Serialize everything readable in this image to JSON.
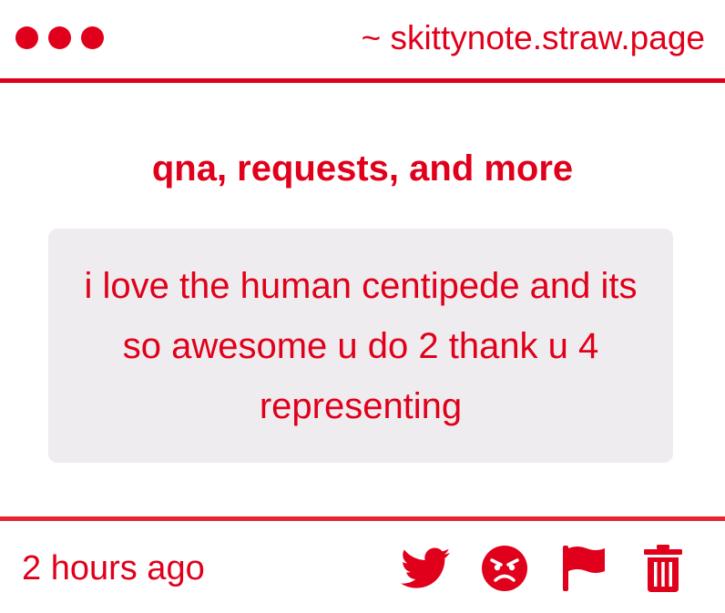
{
  "window": {
    "url": "~ skittynote.straw.page",
    "dots": [
      "dot",
      "dot",
      "dot"
    ]
  },
  "colors": {
    "accent": "#e0001b",
    "box_background": "#eeecee",
    "page_background": "#ffffff"
  },
  "page": {
    "title": "qna, requests, and more"
  },
  "message": {
    "text": "i love the human centipede and its so awesome u do 2 thank u 4 representing"
  },
  "footer": {
    "timestamp": "2 hours ago",
    "actions": [
      {
        "icon": "twitter-icon",
        "name": "share-twitter-button"
      },
      {
        "icon": "angry-face-icon",
        "name": "react-angry-button"
      },
      {
        "icon": "flag-icon",
        "name": "report-button"
      },
      {
        "icon": "trash-icon",
        "name": "delete-button"
      }
    ]
  }
}
